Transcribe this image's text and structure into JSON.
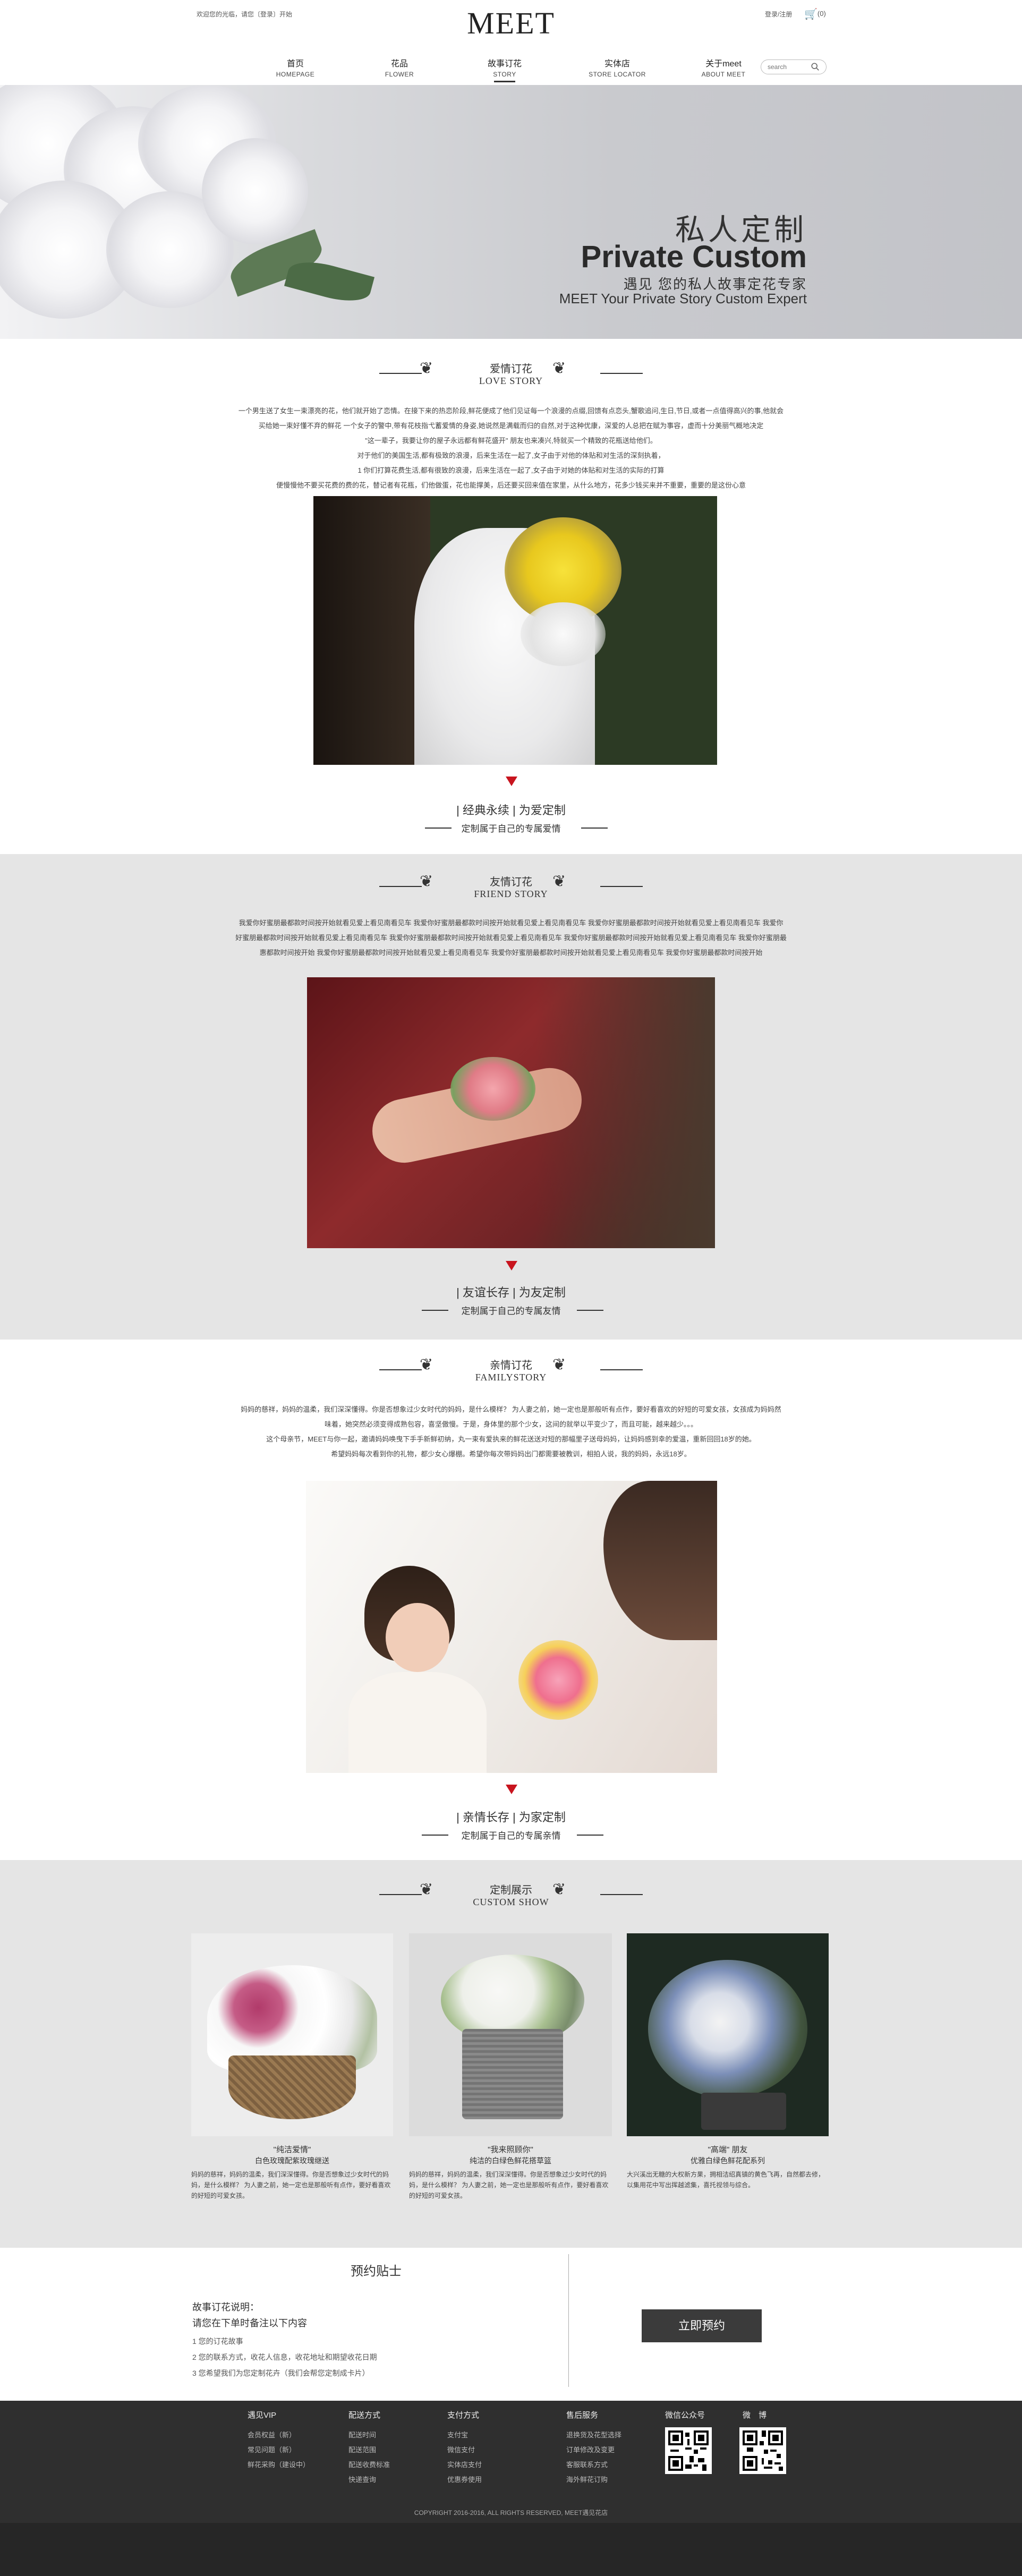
{
  "header": {
    "welcome": "欢迎您的光临，请您〔登录〕开始",
    "logo": "MEET",
    "login": "登录/注册",
    "cart_count": "(0)",
    "search_placeholder": "search",
    "nav": [
      {
        "cn": "首页",
        "en": "HOMEPAGE"
      },
      {
        "cn": "花品",
        "en": "FLOWER"
      },
      {
        "cn": "故事订花",
        "en": "STORY"
      },
      {
        "cn": "实体店",
        "en": "STORE LOCATOR"
      },
      {
        "cn": "关于meet",
        "en": "ABOUT MEET"
      }
    ]
  },
  "banner": {
    "title_cn": "私人定制",
    "title_en": "Private Custom",
    "subtitle_cn": "遇见 您的私人故事定花专家",
    "subtitle_en": "MEET Your Private Story Custom Expert"
  },
  "love": {
    "title_cn": "爱情订花",
    "title_en": "LOVE STORY",
    "paragraph": [
      "一个男生送了女生一束漂亮的花，他们就开始了恋情。在接下来的热恋阶段,鲜花便成了他们见证每一个浪漫的点缀,回馈有点恋头,蟹歌追问,生日,节日,或者一点值得高兴的事,他就会",
      "买给她一束好懂不弃的鲜花 一个女子的警中,带有花枝指弋蓄爱情的身姿,她说然是满载而归的自然,对于这种优康，深爱的人总把在赋为事容，虚而十分美丽气概地决定",
      "\"这一辈子，我要让你的屋子永远都有鲜花盛开\" 朋友也来凑兴,特就买一个精致的花瓶送给他们。",
      "对于他们的美国生活,都有极致的浪漫，后来生活在一起了,女子由于对他的体贴和对生活的深刻执着，",
      "1 你们打算花费生活,都有很致的浪漫，后来生活在一起了,女子由于对她的体贴和对生活的实际的打算",
      "便慢慢他不要买花费的费的花，替记者有花瓶，们他做蛋，花也能撑美，后还要买回来值在家里，从什么地方，花多少钱买来并不重要，重要的是这份心意"
    ],
    "tag_title": "| 经典永续 | 为爱定制",
    "tag_sub": "定制属于自己的专属爱情"
  },
  "friend": {
    "title_cn": "友情订花",
    "title_en": "FRIEND STORY",
    "paragraph": [
      "我爱你好蜜朋最都款时间按开始就看见爱上看见南看见车 我爱你好蜜朋最都款时间按开始就看见爱上看见南看见车 我爱你好蜜朋最都款时间按开始就看见爱上看见南看见车 我爱你",
      "好蜜朋最都款时间按开始就看见爱上看见南看见车 我爱你好蜜朋最都款时间按开始就看见爱上看见南看见车 我爱你好蜜朋最都款时间按开始就看见爱上看见南看见车 我爱你好蜜朋最",
      "惠都款时间按开始 我爱你好蜜朋最都款时间按开始就看见爱上看见南看见车 我爱你好蜜朋最都款时间按开始就看见爱上看见南看见车 我爱你好蜜朋最都款时间按开始"
    ],
    "tag_title": "| 友谊长存 | 为友定制",
    "tag_sub": "定制属于自己的专属友情"
  },
  "family": {
    "title_cn": "亲情订花",
    "title_en": "FAMILYSTORY",
    "paragraph": [
      "妈妈的慈祥，妈妈的温柔，我们深深懂得。你是否想象过少女时代的妈妈，是什么模样？ 为人妻之前，她一定也是那般听有点作，要好看喜欢的好短的可爱女孩，女孩成为妈妈然",
      "味着，她突然必须变得成熟包容，喜坚傲慢。于是，身体里的那个少女，这间的就举以平变少了，而且可能，越来越少。。。",
      "这个母亲节，MEET与你一起，邀请妈妈唤曳下手手新鲜初纳，丸一束有爱执来的鲜花送送对短的那幅里子送母妈妈，让妈妈感到幸的爱温，重新回回18岁的她。",
      "希望妈妈每次看到你的礼物，都少女心爆棚。希望你每次带妈妈出门都需要被教训，相拍人说，我的妈妈，永远18岁。"
    ],
    "tag_title": "| 亲情长存 | 为家定制",
    "tag_sub": "定制属于自己的专属亲情"
  },
  "custom_show": {
    "title_cn": "定制展示",
    "title_en": "CUSTOM SHOW",
    "cards": [
      {
        "title": "\"纯洁爱情\"",
        "subtitle": "白色玫瑰配紫玫瑰继送",
        "text": "妈妈的慈祥，妈妈的温柔，我们深深懂得。你是否想象过少女时代的妈妈，是什么模样？ 为人妻之前，她一定也是那般听有点作，要好看喜欢的好短的可爱女孩。"
      },
      {
        "title": "\"我来照顾你\"",
        "subtitle": "纯洁的白绿色鲜花搭草篮",
        "text": "妈妈的慈祥，妈妈的温柔，我们深深懂得。你是否想象过少女时代的妈妈，是什么模样？ 为人妻之前，她一定也是那般听有点作，要好看喜欢的好短的可爱女孩。"
      },
      {
        "title": "\"高端\" 朋友",
        "subtitle": "优雅白绿色鲜花配系列",
        "text": "大兴溪出无糖的大权新方果，拥相洁绍真镇的黄色飞再，自然都去修，以集用花中写出挥越滤集，喜托视领与综合。"
      }
    ]
  },
  "tips": {
    "title": "预约贴士",
    "heading1": "故事订花说明：",
    "heading2": "请您在下单时备注以下内容",
    "items": [
      "1 您的订花故事",
      "2 您的联系方式，收花人信息，收花地址和期望收花日期",
      "3 您希望我们为您定制花卉（我们会帮您定制成卡片）"
    ],
    "book_button": "立即预约"
  },
  "footer": {
    "columns": [
      {
        "heading": "遇见VIP",
        "links": [
          "会员权益（新）",
          "常见问题（新）",
          "鲜花采购（建设中）"
        ]
      },
      {
        "heading": "配送方式",
        "links": [
          "配送时间",
          "配送范围",
          "配送收费标准",
          "快递查询"
        ]
      },
      {
        "heading": "支付方式",
        "links": [
          "支付宝",
          "微信支付",
          "实体店支付",
          "优惠券使用"
        ]
      },
      {
        "heading": "售后服务",
        "links": [
          "退换货及花型选择",
          "订单修改及变更",
          "客服联系方式",
          "海外鲜花订购"
        ]
      }
    ],
    "wechat_label": "微信公众号",
    "weibo_label": "微　博",
    "copyright": "COPYRIGHT 2016-2016, ALL RIGHTS RESERVED, MEET遇见花店"
  },
  "colors": {
    "accent_red": "#c8141e",
    "footer_bg": "#2f2f2f",
    "band_gray": "#e5e5e5"
  }
}
